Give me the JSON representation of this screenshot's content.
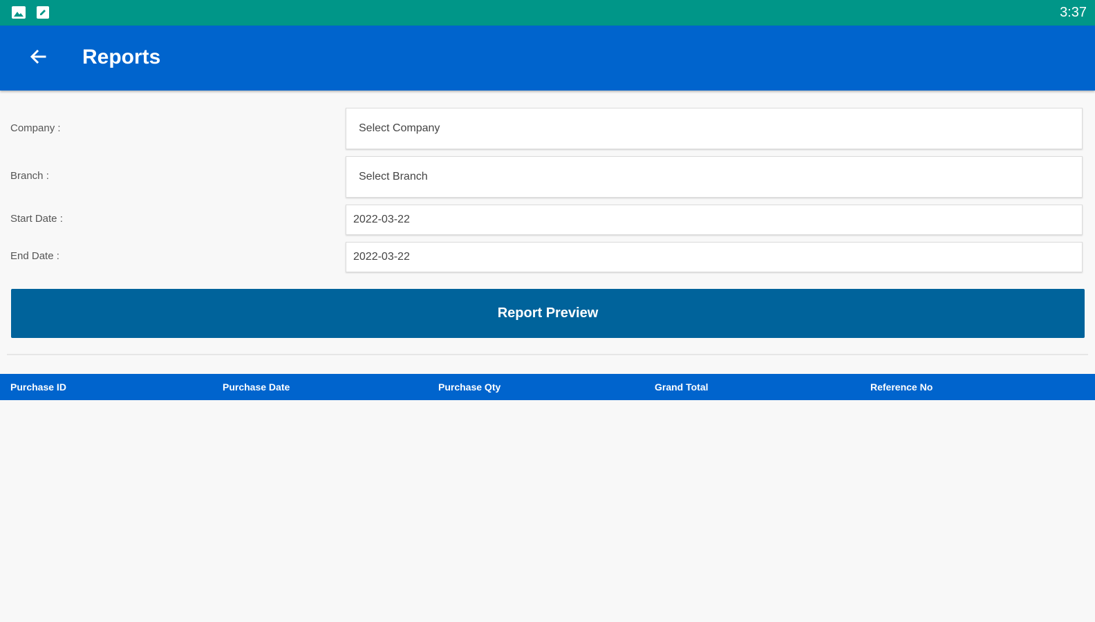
{
  "status_bar": {
    "time": "3:37",
    "icons": [
      "image-icon",
      "edit-icon"
    ],
    "color": "#009688"
  },
  "app_bar": {
    "title": "Reports",
    "back_icon": "arrow-left-icon",
    "color": "#0064cd"
  },
  "form": {
    "company_label": "Company :",
    "company_value": "Select Company",
    "branch_label": "Branch :",
    "branch_value": "Select Branch",
    "start_date_label": "Start Date :",
    "start_date_value": "2022-03-22",
    "end_date_label": "End Date :",
    "end_date_value": "2022-03-22"
  },
  "preview_button": {
    "label": "Report Preview",
    "color": "#00639b"
  },
  "table": {
    "columns": [
      "Purchase ID",
      "Purchase Date",
      "Purchase Qty",
      "Grand Total",
      "Reference No"
    ],
    "rows": []
  }
}
